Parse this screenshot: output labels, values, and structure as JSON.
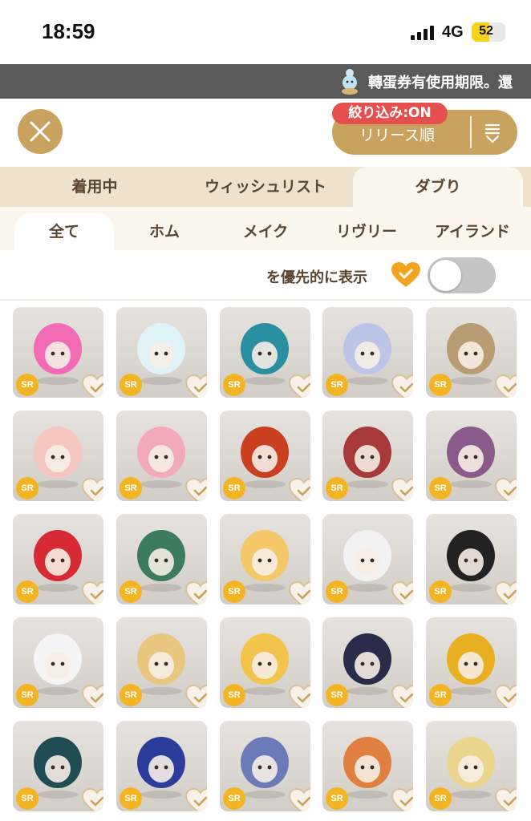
{
  "status_bar": {
    "time": "18:59",
    "network": "4G",
    "battery": "52"
  },
  "banner": {
    "text": "轉蛋券有使用期限。還"
  },
  "controls": {
    "filter_badge": "絞り込み:ON",
    "sort_label": "リリース順"
  },
  "main_tabs": [
    {
      "label": "着用中",
      "active": false
    },
    {
      "label": "ウィッシュリスト",
      "active": false
    },
    {
      "label": "ダブり",
      "active": true
    }
  ],
  "sub_tabs": [
    {
      "label": "全て",
      "active": true
    },
    {
      "label": "ホム",
      "active": false
    },
    {
      "label": "メイク",
      "active": false
    },
    {
      "label": "リヴリー",
      "active": false
    },
    {
      "label": "アイランド",
      "active": false
    }
  ],
  "priority": {
    "label": "を優先的に表示",
    "toggle_on": false
  },
  "colors": {
    "accent": "#c9a260",
    "badge": "#e5504f",
    "rarity": "#f2b422",
    "heart": "#f2a41f"
  },
  "items": [
    {
      "rarity": "SR",
      "icon": "pink-hair-creature-icon",
      "color": "#f36bb5"
    },
    {
      "rarity": "SR",
      "icon": "paper-plane-icon",
      "color": "#dff3f6"
    },
    {
      "rarity": "SR",
      "icon": "blue-dragon-icon",
      "color": "#2a8fa0"
    },
    {
      "rarity": "SR",
      "icon": "lavender-twin-tail-hair-icon",
      "color": "#bcc5e8"
    },
    {
      "rarity": "SR",
      "icon": "hooded-bear-icon",
      "color": "#b89c72"
    },
    {
      "rarity": "SR",
      "icon": "heart-aura-icon",
      "color": "#f6c7c0"
    },
    {
      "rarity": "SR",
      "icon": "pink-curly-hair-icon",
      "color": "#f2a9b8"
    },
    {
      "rarity": "SR",
      "icon": "red-monkey-icon",
      "color": "#c8401f"
    },
    {
      "rarity": "SR",
      "icon": "red-eye-makeup-icon",
      "color": "#a63a3a"
    },
    {
      "rarity": "SR",
      "icon": "purple-eye-makeup-icon",
      "color": "#8a5a8a"
    },
    {
      "rarity": "SR",
      "icon": "red-ornament-icon",
      "color": "#d62a35"
    },
    {
      "rarity": "SR",
      "icon": "green-gradient-hair-icon",
      "color": "#3c7b5c"
    },
    {
      "rarity": "SR",
      "icon": "yellow-elephant-icon",
      "color": "#f4c868"
    },
    {
      "rarity": "SR",
      "icon": "white-crystal-gown-icon",
      "color": "#f2f2f2"
    },
    {
      "rarity": "SR",
      "icon": "black-long-hair-icon",
      "color": "#222222"
    },
    {
      "rarity": "SR",
      "icon": "chandelier-icon",
      "color": "#f4f4f4"
    },
    {
      "rarity": "SR",
      "icon": "sleeping-cat-icon",
      "color": "#e9c680"
    },
    {
      "rarity": "SR",
      "icon": "bee-creature-icon",
      "color": "#f3c44b"
    },
    {
      "rarity": "SR",
      "icon": "kimono-outfit-icon",
      "color": "#2b2b4a"
    },
    {
      "rarity": "SR",
      "icon": "kagami-mochi-icon",
      "color": "#e8b020"
    },
    {
      "rarity": "SR",
      "icon": "bun-hair-icon",
      "color": "#1f4d53"
    },
    {
      "rarity": "SR",
      "icon": "reindeer-creature-icon",
      "color": "#2c3c9a"
    },
    {
      "rarity": "SR",
      "icon": "blue-eye-makeup-icon",
      "color": "#6a7bb8"
    },
    {
      "rarity": "SR",
      "icon": "orange-eye-makeup-icon",
      "color": "#e08040"
    },
    {
      "rarity": "SR",
      "icon": "garland-decoration-icon",
      "color": "#e9d68c"
    }
  ]
}
